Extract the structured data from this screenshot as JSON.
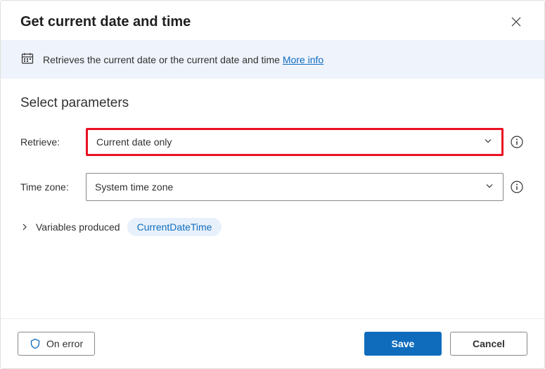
{
  "header": {
    "title": "Get current date and time"
  },
  "banner": {
    "text": "Retrieves the current date or the current date and time",
    "more_info": "More info"
  },
  "section": {
    "title": "Select parameters"
  },
  "fields": {
    "retrieve": {
      "label": "Retrieve:",
      "value": "Current date only"
    },
    "timezone": {
      "label": "Time zone:",
      "value": "System time zone"
    }
  },
  "variables": {
    "label": "Variables produced",
    "chip": "CurrentDateTime"
  },
  "footer": {
    "on_error": "On error",
    "save": "Save",
    "cancel": "Cancel"
  }
}
